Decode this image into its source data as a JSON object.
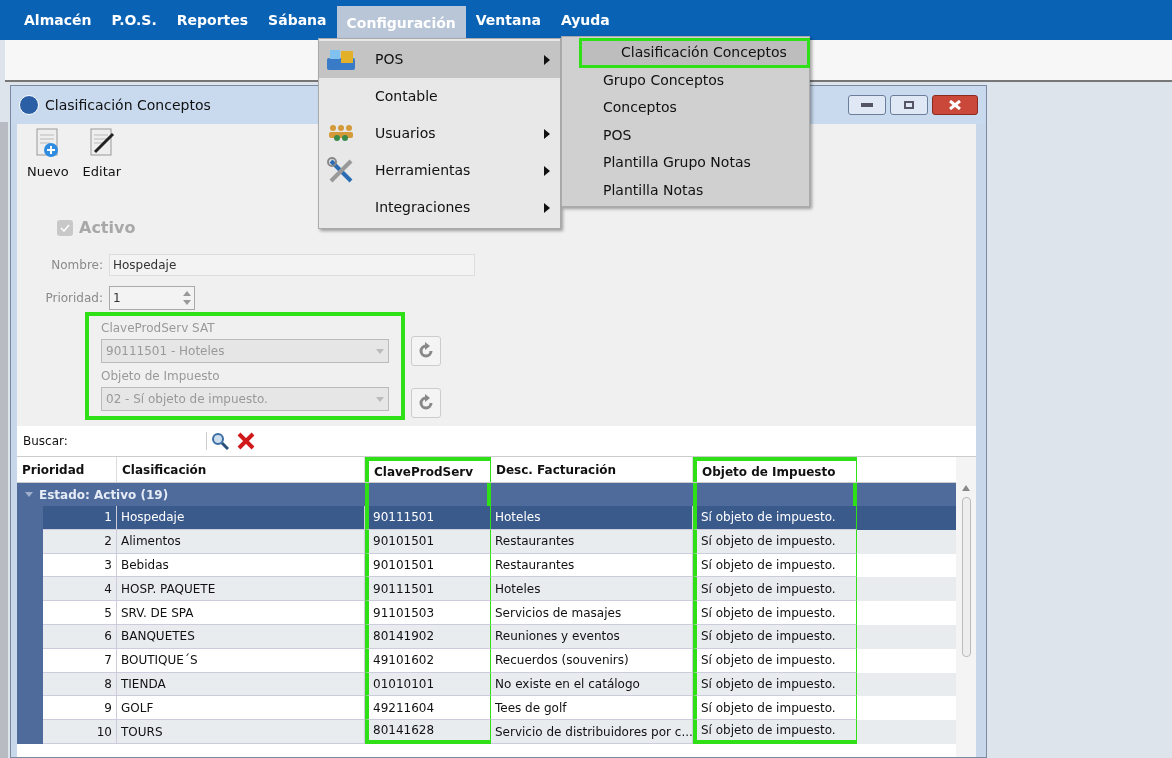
{
  "menubar": [
    {
      "label": "Almacén",
      "selected": false
    },
    {
      "label": "P.O.S.",
      "selected": false
    },
    {
      "label": "Reportes",
      "selected": false
    },
    {
      "label": "Sábana",
      "selected": false
    },
    {
      "label": "Configuración",
      "selected": true
    },
    {
      "label": "Ventana",
      "selected": false
    },
    {
      "label": "Ayuda",
      "selected": false
    }
  ],
  "dropdown": [
    {
      "label": "POS",
      "kind": "pos",
      "submenu": true,
      "selected": true
    },
    {
      "label": "Contable",
      "kind": "plain",
      "submenu": false,
      "selected": false
    },
    {
      "label": "Usuarios",
      "kind": "users",
      "submenu": true,
      "selected": false
    },
    {
      "label": "Herramientas",
      "kind": "tools",
      "submenu": true,
      "selected": false
    },
    {
      "label": "Integraciones",
      "kind": "plain",
      "submenu": true,
      "selected": false
    }
  ],
  "submenu": [
    {
      "label": "Clasificación Conceptos",
      "selected": true,
      "highlighted": true
    },
    {
      "label": "Grupo Conceptos",
      "selected": false,
      "highlighted": false
    },
    {
      "label": "Conceptos",
      "selected": false,
      "highlighted": false
    },
    {
      "label": "POS",
      "selected": false,
      "highlighted": false
    },
    {
      "label": "Plantilla Grupo Notas",
      "selected": false,
      "highlighted": false
    },
    {
      "label": "Plantilla Notas",
      "selected": false,
      "highlighted": false
    }
  ],
  "window": {
    "title": "Clasificación Conceptos"
  },
  "toolbar": [
    {
      "label": "Nuevo",
      "kind": "new"
    },
    {
      "label": "Editar",
      "kind": "edit"
    }
  ],
  "form": {
    "activo": {
      "label": "Activo",
      "checked": true
    },
    "nombre": {
      "label": "Nombre:",
      "value": "Hospedaje"
    },
    "prioridad": {
      "label": "Prioridad:",
      "value": "1"
    },
    "sat_group": {
      "highlighted": true,
      "fields": [
        {
          "label": "ClaveProdServ SAT",
          "value": "90111501 - Hoteles"
        },
        {
          "label": "Objeto de Impuesto",
          "value": "02 - Sí objeto de impuesto."
        }
      ]
    }
  },
  "search": {
    "label": "Buscar:"
  },
  "table": {
    "columns": [
      {
        "label": "Prioridad",
        "highlighted": false
      },
      {
        "label": "Clasificación",
        "highlighted": false
      },
      {
        "label": "ClaveProdServ",
        "highlighted": true
      },
      {
        "label": "Desc. Facturación",
        "highlighted": false
      },
      {
        "label": "Objeto de Impuesto",
        "highlighted": true
      }
    ],
    "group": "Estado: Activo (19)",
    "rows": [
      {
        "cells": [
          "1",
          "Hospedaje",
          "90111501",
          "Hoteles",
          "Sí objeto de impuesto."
        ],
        "selected": true
      },
      {
        "cells": [
          "2",
          "Alimentos",
          "90101501",
          "Restaurantes",
          "Sí objeto de impuesto."
        ],
        "selected": false
      },
      {
        "cells": [
          "3",
          "Bebidas",
          "90101501",
          "Restaurantes",
          "Sí objeto de impuesto."
        ],
        "selected": false
      },
      {
        "cells": [
          "4",
          "HOSP. PAQUETE",
          "90111501",
          "Hoteles",
          "Sí objeto de impuesto."
        ],
        "selected": false
      },
      {
        "cells": [
          "5",
          "SRV. DE SPA",
          "91101503",
          "Servicios de masajes",
          "Sí objeto de impuesto."
        ],
        "selected": false
      },
      {
        "cells": [
          "6",
          "BANQUETES",
          "80141902",
          "Reuniones y eventos",
          "Sí objeto de impuesto."
        ],
        "selected": false
      },
      {
        "cells": [
          "7",
          "BOUTIQUE´S",
          "49101602",
          "Recuerdos (souvenirs)",
          "Sí objeto de impuesto."
        ],
        "selected": false
      },
      {
        "cells": [
          "8",
          "TIENDA",
          "01010101",
          "No existe en el catálogo",
          "Sí objeto de impuesto."
        ],
        "selected": false
      },
      {
        "cells": [
          "9",
          "GOLF",
          "49211604",
          "Tees de golf",
          "Sí objeto de impuesto."
        ],
        "selected": false
      },
      {
        "cells": [
          "10",
          "TOURS",
          "80141628",
          "Servicio de distribuidores por c...",
          "Sí objeto de impuesto."
        ],
        "selected": false
      }
    ]
  }
}
